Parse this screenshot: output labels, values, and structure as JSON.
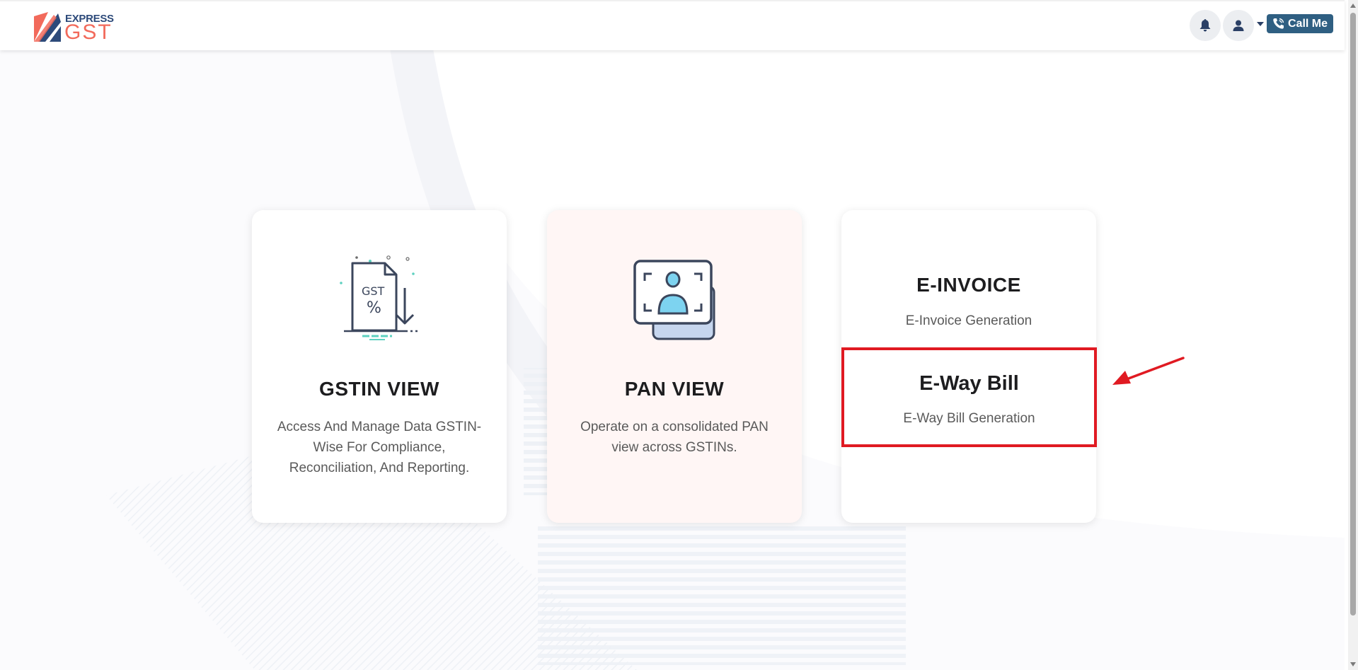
{
  "header": {
    "logo_top": "EXPRESS",
    "logo_bottom": "GST",
    "call_label": "Call Me"
  },
  "cards": [
    {
      "title": "GSTIN VIEW",
      "description": "Access And Manage Data GSTIN-Wise For Compliance, Reconciliation, And Reporting.",
      "illustration_text": "GST",
      "illustration_symbol": "%",
      "icon": "gst-document-download-icon"
    },
    {
      "title": "PAN VIEW",
      "description": "Operate on a consolidated PAN view across GSTINs.",
      "icon": "pan-id-card-icon"
    },
    {
      "title": "E-INVOICE",
      "description": "E-Invoice Generation"
    }
  ],
  "eway": {
    "title": "E-Way Bill",
    "description": "E-Way Bill Generation"
  },
  "colors": {
    "accent": "#f26a5b",
    "brand_dark": "#2d4a7a",
    "call_button": "#2f5f82",
    "highlight": "#e01a22",
    "pan_card_bg": "#fff6f5"
  },
  "icons": [
    "bell-icon",
    "user-icon",
    "phone-icon",
    "logo-mark-icon"
  ]
}
